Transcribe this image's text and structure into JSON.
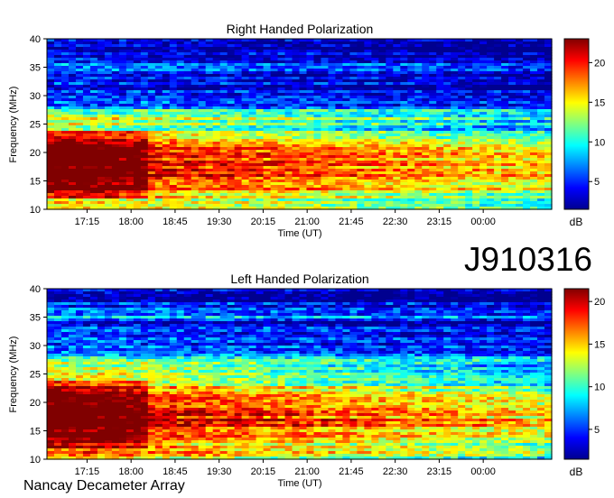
{
  "figure": {
    "id_label": "J910316",
    "footer": "Nancay Decameter Array"
  },
  "colors": {
    "colormap": [
      "#00008f",
      "#0000ff",
      "#0080ff",
      "#00ffff",
      "#80ff80",
      "#ffff00",
      "#ff8000",
      "#ff0000",
      "#800000"
    ]
  },
  "chart_data": [
    {
      "type": "heatmap",
      "title": "Right Handed Polarization",
      "xlabel": "Time (UT)",
      "ylabel": "Frequency (MHz)",
      "x_ticks": [
        "17:15",
        "18:00",
        "18:45",
        "19:30",
        "20:15",
        "21:00",
        "21:45",
        "22:30",
        "23:15",
        "00:00"
      ],
      "x_range": [
        "16:34",
        "01:10"
      ],
      "ylim": [
        10,
        40
      ],
      "y_ticks": [
        10,
        15,
        20,
        25,
        30,
        35,
        40
      ],
      "colorbar": {
        "label": "dB",
        "ticks": [
          5,
          10,
          15,
          20
        ],
        "range": [
          1.5,
          23
        ]
      },
      "intensity_profile_mhz_db": [
        [
          10,
          18
        ],
        [
          12,
          16
        ],
        [
          14,
          21
        ],
        [
          16,
          22
        ],
        [
          18,
          22
        ],
        [
          20,
          21
        ],
        [
          22,
          19
        ],
        [
          24,
          13
        ],
        [
          26,
          15
        ],
        [
          28,
          8
        ],
        [
          30,
          4
        ],
        [
          32,
          5
        ],
        [
          34,
          4
        ],
        [
          35,
          8
        ],
        [
          36,
          4
        ],
        [
          38,
          4
        ],
        [
          40,
          3
        ]
      ]
    },
    {
      "type": "heatmap",
      "title": "Left Handed Polarization",
      "xlabel": "Time (UT)",
      "ylabel": "Frequency (MHz)",
      "x_ticks": [
        "17:15",
        "18:00",
        "18:45",
        "19:30",
        "20:15",
        "21:00",
        "21:45",
        "22:30",
        "23:15",
        "00:00"
      ],
      "x_range": [
        "16:34",
        "01:10"
      ],
      "ylim": [
        10,
        40
      ],
      "y_ticks": [
        10,
        15,
        20,
        25,
        30,
        35,
        40
      ],
      "colorbar": {
        "label": "dB",
        "ticks": [
          5,
          10,
          15,
          20
        ],
        "range": [
          1.5,
          21.5
        ]
      },
      "intensity_profile_mhz_db": [
        [
          10,
          16
        ],
        [
          12,
          17
        ],
        [
          14,
          19
        ],
        [
          16,
          21
        ],
        [
          18,
          21
        ],
        [
          20,
          20
        ],
        [
          22,
          18
        ],
        [
          24,
          14
        ],
        [
          26,
          15
        ],
        [
          28,
          9
        ],
        [
          30,
          5
        ],
        [
          32,
          5
        ],
        [
          34,
          4
        ],
        [
          35,
          9
        ],
        [
          36,
          5
        ],
        [
          38,
          4
        ],
        [
          40,
          3
        ]
      ]
    }
  ]
}
